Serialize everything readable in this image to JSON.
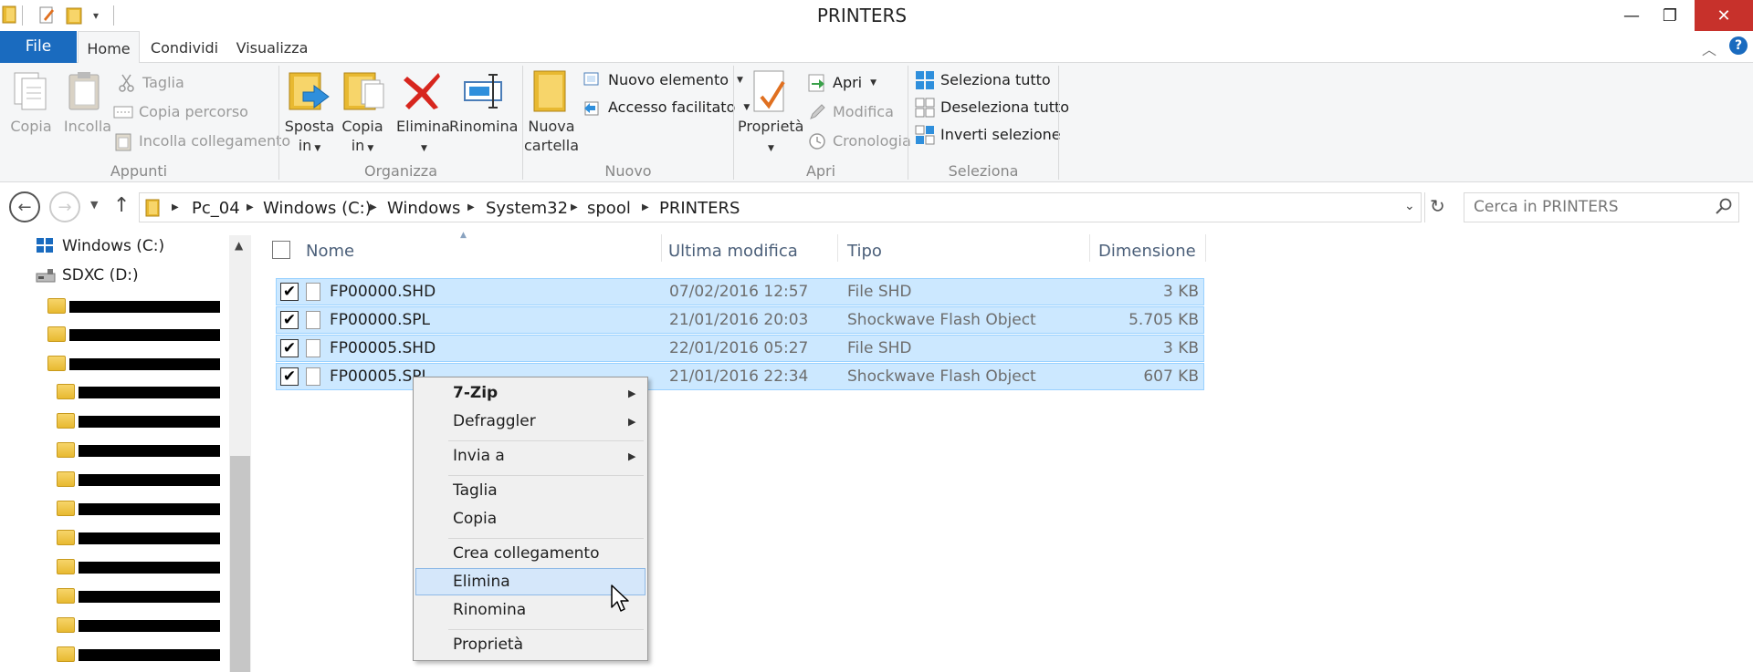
{
  "window": {
    "title": "PRINTERS"
  },
  "title_controls": {
    "minimize": "—",
    "restore": "❐",
    "close": "✕"
  },
  "tabs": {
    "file": "File",
    "home": "Home",
    "share": "Condividi",
    "view": "Visualizza"
  },
  "ribbon": {
    "clipboard": {
      "copy": "Copia",
      "paste": "Incolla",
      "cut": "Taglia",
      "copy_path": "Copia percorso",
      "paste_shortcut": "Incolla collegamento",
      "group": "Appunti"
    },
    "organize": {
      "move_to_l1": "Sposta",
      "move_to_l2": "in",
      "copy_to_l1": "Copia",
      "copy_to_l2": "in",
      "delete": "Elimina",
      "rename": "Rinomina",
      "group": "Organizza"
    },
    "new": {
      "new_folder_l1": "Nuova",
      "new_folder_l2": "cartella",
      "new_item": "Nuovo elemento",
      "easy_access": "Accesso facilitato",
      "group": "Nuovo"
    },
    "open": {
      "properties": "Proprietà",
      "open": "Apri",
      "edit": "Modifica",
      "history": "Cronologia",
      "group": "Apri"
    },
    "select": {
      "select_all": "Seleziona tutto",
      "select_none": "Deseleziona tutto",
      "invert": "Inverti selezione",
      "group": "Seleziona"
    }
  },
  "address": {
    "crumbs": [
      "Pc_04",
      "Windows (C:)",
      "Windows",
      "System32",
      "spool",
      "PRINTERS"
    ]
  },
  "search": {
    "placeholder": "Cerca in PRINTERS"
  },
  "tree": {
    "items": [
      "Windows (C:)",
      "SDXC (D:)"
    ]
  },
  "columns": {
    "name": "Nome",
    "modified": "Ultima modifica",
    "type": "Tipo",
    "size": "Dimensione"
  },
  "files": [
    {
      "name": "FP00000.SHD",
      "modified": "07/02/2016 12:57",
      "type": "File SHD",
      "size": "3 KB"
    },
    {
      "name": "FP00000.SPL",
      "modified": "21/01/2016 20:03",
      "type": "Shockwave Flash Object",
      "size": "5.705 KB"
    },
    {
      "name": "FP00005.SHD",
      "modified": "22/01/2016 05:27",
      "type": "File SHD",
      "size": "3 KB"
    },
    {
      "name": "FP00005.SPL",
      "modified": "21/01/2016 22:34",
      "type": "Shockwave Flash Object",
      "size": "607 KB"
    }
  ],
  "context_menu": {
    "items": [
      "7-Zip",
      "Defraggler",
      "Invia a",
      "Taglia",
      "Copia",
      "Crea collegamento",
      "Elimina",
      "Rinomina",
      "Proprietà"
    ],
    "highlighted": "Elimina"
  },
  "colors": {
    "accent": "#1a6bbf",
    "selection": "#cce8ff",
    "close": "#c7312b"
  }
}
